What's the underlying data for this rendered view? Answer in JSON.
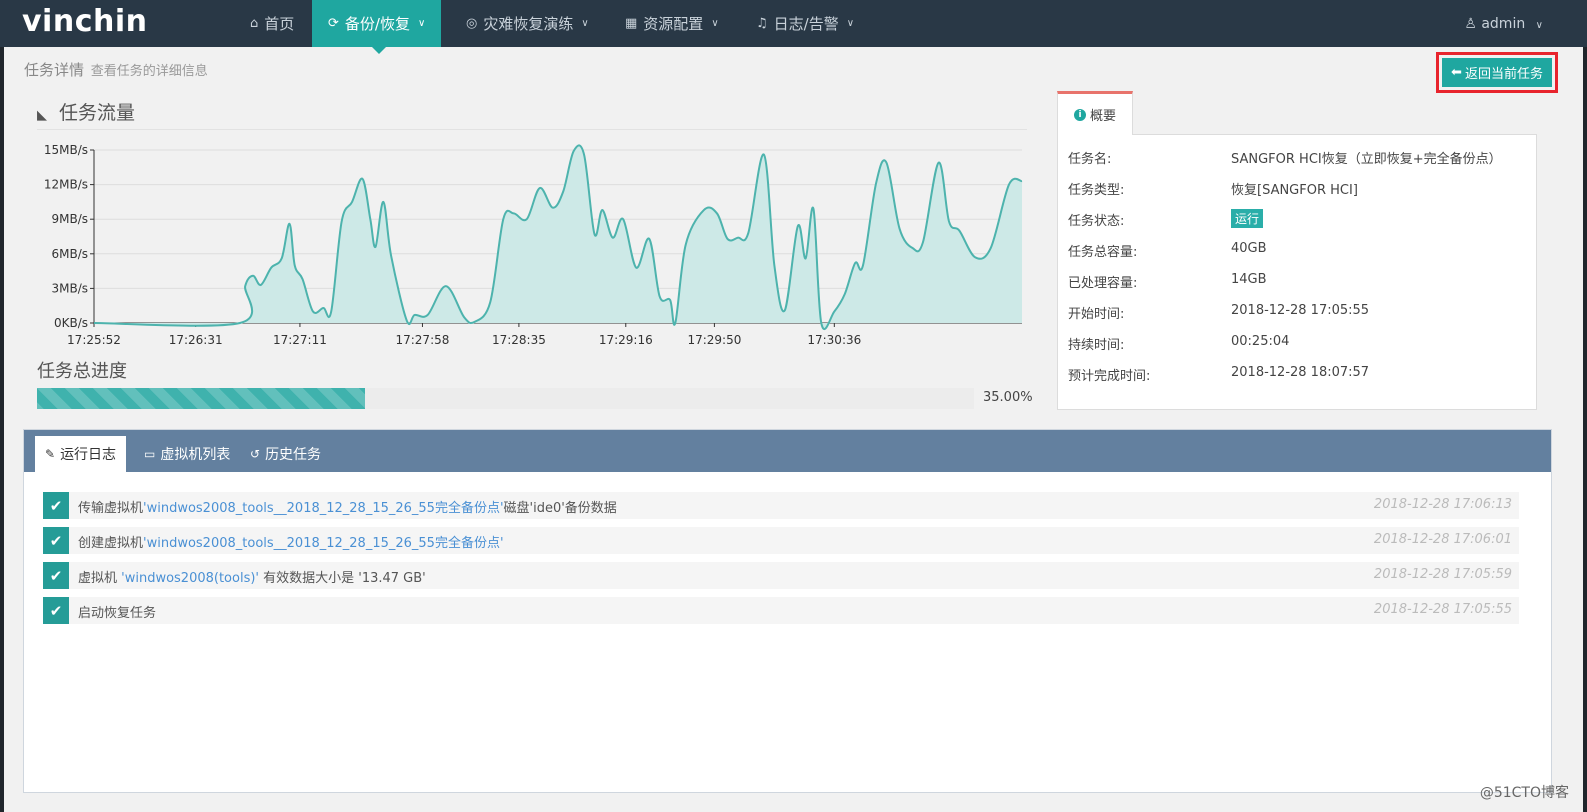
{
  "brand": "vinchin",
  "nav": [
    {
      "label": "首页",
      "icon": "home-icon",
      "active": false
    },
    {
      "label": "备份/恢复",
      "icon": "refresh-icon",
      "active": true
    },
    {
      "label": "灾难恢复演练",
      "icon": "drill-icon",
      "active": false
    },
    {
      "label": "资源配置",
      "icon": "grid-icon",
      "active": false
    },
    {
      "label": "日志/告警",
      "icon": "bell-icon",
      "active": false
    }
  ],
  "user": {
    "name": "admin"
  },
  "breadcrumb": {
    "title": "任务详情",
    "subtitle": "查看任务的详细信息"
  },
  "back_button": {
    "label": "返回当前任务"
  },
  "flow_title": "任务流量",
  "chart_data": {
    "type": "area",
    "title": "任务流量",
    "y_unit": "MB/s",
    "y_ticks": [
      "0KB/s",
      "3MB/s",
      "6MB/s",
      "9MB/s",
      "12MB/s",
      "15MB/s"
    ],
    "ylim": [
      0,
      15
    ],
    "x_ticks": [
      "17:25:52",
      "17:26:31",
      "17:27:11",
      "17:27:58",
      "17:28:35",
      "17:29:16",
      "17:29:50",
      "17:30:36"
    ],
    "xlim": [
      "17:25:52",
      "17:31:48"
    ],
    "grid": true,
    "color": "#4db3ad",
    "fill": "#cde9e7",
    "points": [
      [
        "17:25:52",
        0
      ],
      [
        "17:26:48",
        0
      ],
      [
        "17:26:50",
        3.2
      ],
      [
        "17:26:53",
        4.1
      ],
      [
        "17:26:56",
        3.3
      ],
      [
        "17:27:00",
        4.8
      ],
      [
        "17:27:04",
        5.6
      ],
      [
        "17:27:07",
        8.6
      ],
      [
        "17:27:09",
        5.0
      ],
      [
        "17:27:12",
        3.8
      ],
      [
        "17:27:16",
        1.0
      ],
      [
        "17:27:20",
        1.3
      ],
      [
        "17:27:23",
        1.0
      ],
      [
        "17:27:27",
        8.8
      ],
      [
        "17:27:31",
        10.5
      ],
      [
        "17:27:35",
        12.5
      ],
      [
        "17:27:38",
        9.0
      ],
      [
        "17:27:40",
        6.6
      ],
      [
        "17:27:43",
        10.5
      ],
      [
        "17:27:46",
        5.8
      ],
      [
        "17:27:52",
        0.2
      ],
      [
        "17:27:55",
        0.7
      ],
      [
        "17:28:00",
        0.7
      ],
      [
        "17:28:07",
        3.2
      ],
      [
        "17:28:14",
        0.5
      ],
      [
        "17:28:18",
        0.1
      ],
      [
        "17:28:24",
        1.8
      ],
      [
        "17:28:29",
        9.0
      ],
      [
        "17:28:33",
        9.5
      ],
      [
        "17:28:38",
        9.0
      ],
      [
        "17:28:43",
        11.7
      ],
      [
        "17:28:48",
        10.0
      ],
      [
        "17:28:52",
        11.4
      ],
      [
        "17:28:56",
        14.9
      ],
      [
        "17:29:00",
        14.6
      ],
      [
        "17:29:04",
        7.7
      ],
      [
        "17:29:07",
        9.8
      ],
      [
        "17:29:11",
        7.4
      ],
      [
        "17:29:15",
        9.0
      ],
      [
        "17:29:20",
        4.8
      ],
      [
        "17:29:25",
        7.3
      ],
      [
        "17:29:29",
        2.3
      ],
      [
        "17:29:33",
        2.0
      ],
      [
        "17:29:35",
        0.0
      ],
      [
        "17:29:39",
        6.8
      ],
      [
        "17:29:46",
        9.8
      ],
      [
        "17:29:51",
        9.5
      ],
      [
        "17:29:55",
        7.3
      ],
      [
        "17:29:59",
        7.4
      ],
      [
        "17:30:03",
        7.8
      ],
      [
        "17:30:09",
        14.6
      ],
      [
        "17:30:13",
        5.0
      ],
      [
        "17:30:17",
        1.1
      ],
      [
        "17:30:22",
        8.4
      ],
      [
        "17:30:25",
        5.6
      ],
      [
        "17:30:28",
        9.9
      ],
      [
        "17:30:31",
        0.0
      ],
      [
        "17:30:36",
        1.0
      ],
      [
        "17:30:40",
        2.5
      ],
      [
        "17:30:44",
        5.2
      ],
      [
        "17:30:47",
        5.0
      ],
      [
        "17:30:52",
        12.1
      ],
      [
        "17:30:56",
        13.9
      ],
      [
        "17:31:01",
        8.2
      ],
      [
        "17:31:06",
        6.5
      ],
      [
        "17:31:10",
        7.0
      ],
      [
        "17:31:16",
        13.9
      ],
      [
        "17:31:20",
        8.8
      ],
      [
        "17:31:24",
        8.0
      ],
      [
        "17:31:30",
        5.7
      ],
      [
        "17:31:36",
        6.5
      ],
      [
        "17:31:43",
        12.0
      ],
      [
        "17:31:48",
        12.3
      ]
    ]
  },
  "progress": {
    "title": "任务总进度",
    "value": 0.35,
    "label": "35.00%"
  },
  "summary": {
    "tab_label": "概要",
    "rows": [
      {
        "label": "任务名:",
        "value": "SANGFOR HCI恢复（立即恢复+完全备份点）"
      },
      {
        "label": "任务类型:",
        "value": "恢复[SANGFOR HCI]"
      },
      {
        "label": "任务状态:",
        "value": "运行"
      },
      {
        "label": "任务总容量:",
        "value": "40GB"
      },
      {
        "label": "已处理容量:",
        "value": "14GB"
      },
      {
        "label": "开始时间:",
        "value": "2018-12-28 17:05:55"
      },
      {
        "label": "持续时间:",
        "value": "00:25:04"
      },
      {
        "label": "预计完成时间:",
        "value": "2018-12-28 18:07:57"
      }
    ]
  },
  "log_tabs": [
    {
      "label": "运行日志",
      "icon": "edit-icon",
      "active": true
    },
    {
      "label": "虚拟机列表",
      "icon": "server-icon",
      "active": false
    },
    {
      "label": "历史任务",
      "icon": "history-icon",
      "active": false
    }
  ],
  "logs": [
    {
      "prefix": "传输虚拟机",
      "highlight": "'windwos2008_tools__2018_12_28_15_26_55完全备份点'",
      "suffix": "磁盘'ide0'备份数据",
      "time": "2018-12-28 17:06:13"
    },
    {
      "prefix": "创建虚拟机",
      "highlight": "'windwos2008_tools__2018_12_28_15_26_55完全备份点'",
      "suffix": "",
      "time": "2018-12-28 17:06:01"
    },
    {
      "prefix": "虚拟机 ",
      "highlight": "'windwos2008(tools)'",
      "suffix": " 有效数据大小是 '13.47 GB'",
      "time": "2018-12-28 17:05:59"
    },
    {
      "prefix": "启动恢复任务",
      "highlight": "",
      "suffix": "",
      "time": "2018-12-28 17:05:55"
    }
  ],
  "watermark": "@51CTO博客"
}
